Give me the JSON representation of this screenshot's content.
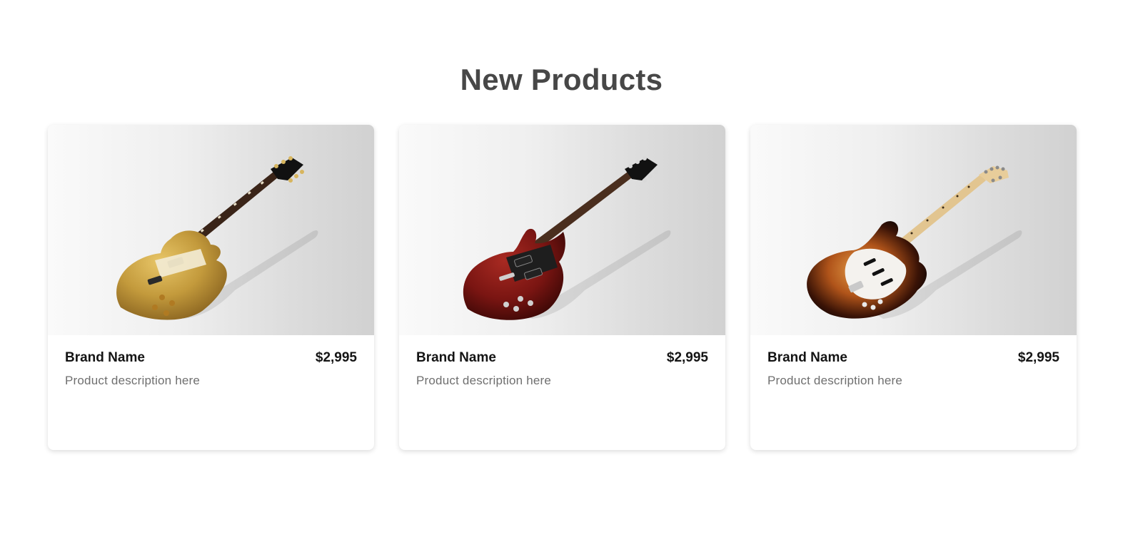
{
  "section": {
    "title": "New Products"
  },
  "products": [
    {
      "brand": "Brand Name",
      "price": "$2,995",
      "description": "Product description here",
      "image": "gold-les-paul-guitar-image",
      "finish_color": "#c39a3c"
    },
    {
      "brand": "Brand Name",
      "price": "$2,995",
      "description": "Product description here",
      "image": "red-sg-guitar-image",
      "finish_color": "#7a1512"
    },
    {
      "brand": "Brand Name",
      "price": "$2,995",
      "description": "Product description here",
      "image": "sunburst-stratocaster-guitar-image",
      "finish_color": "#8a3a10"
    }
  ]
}
